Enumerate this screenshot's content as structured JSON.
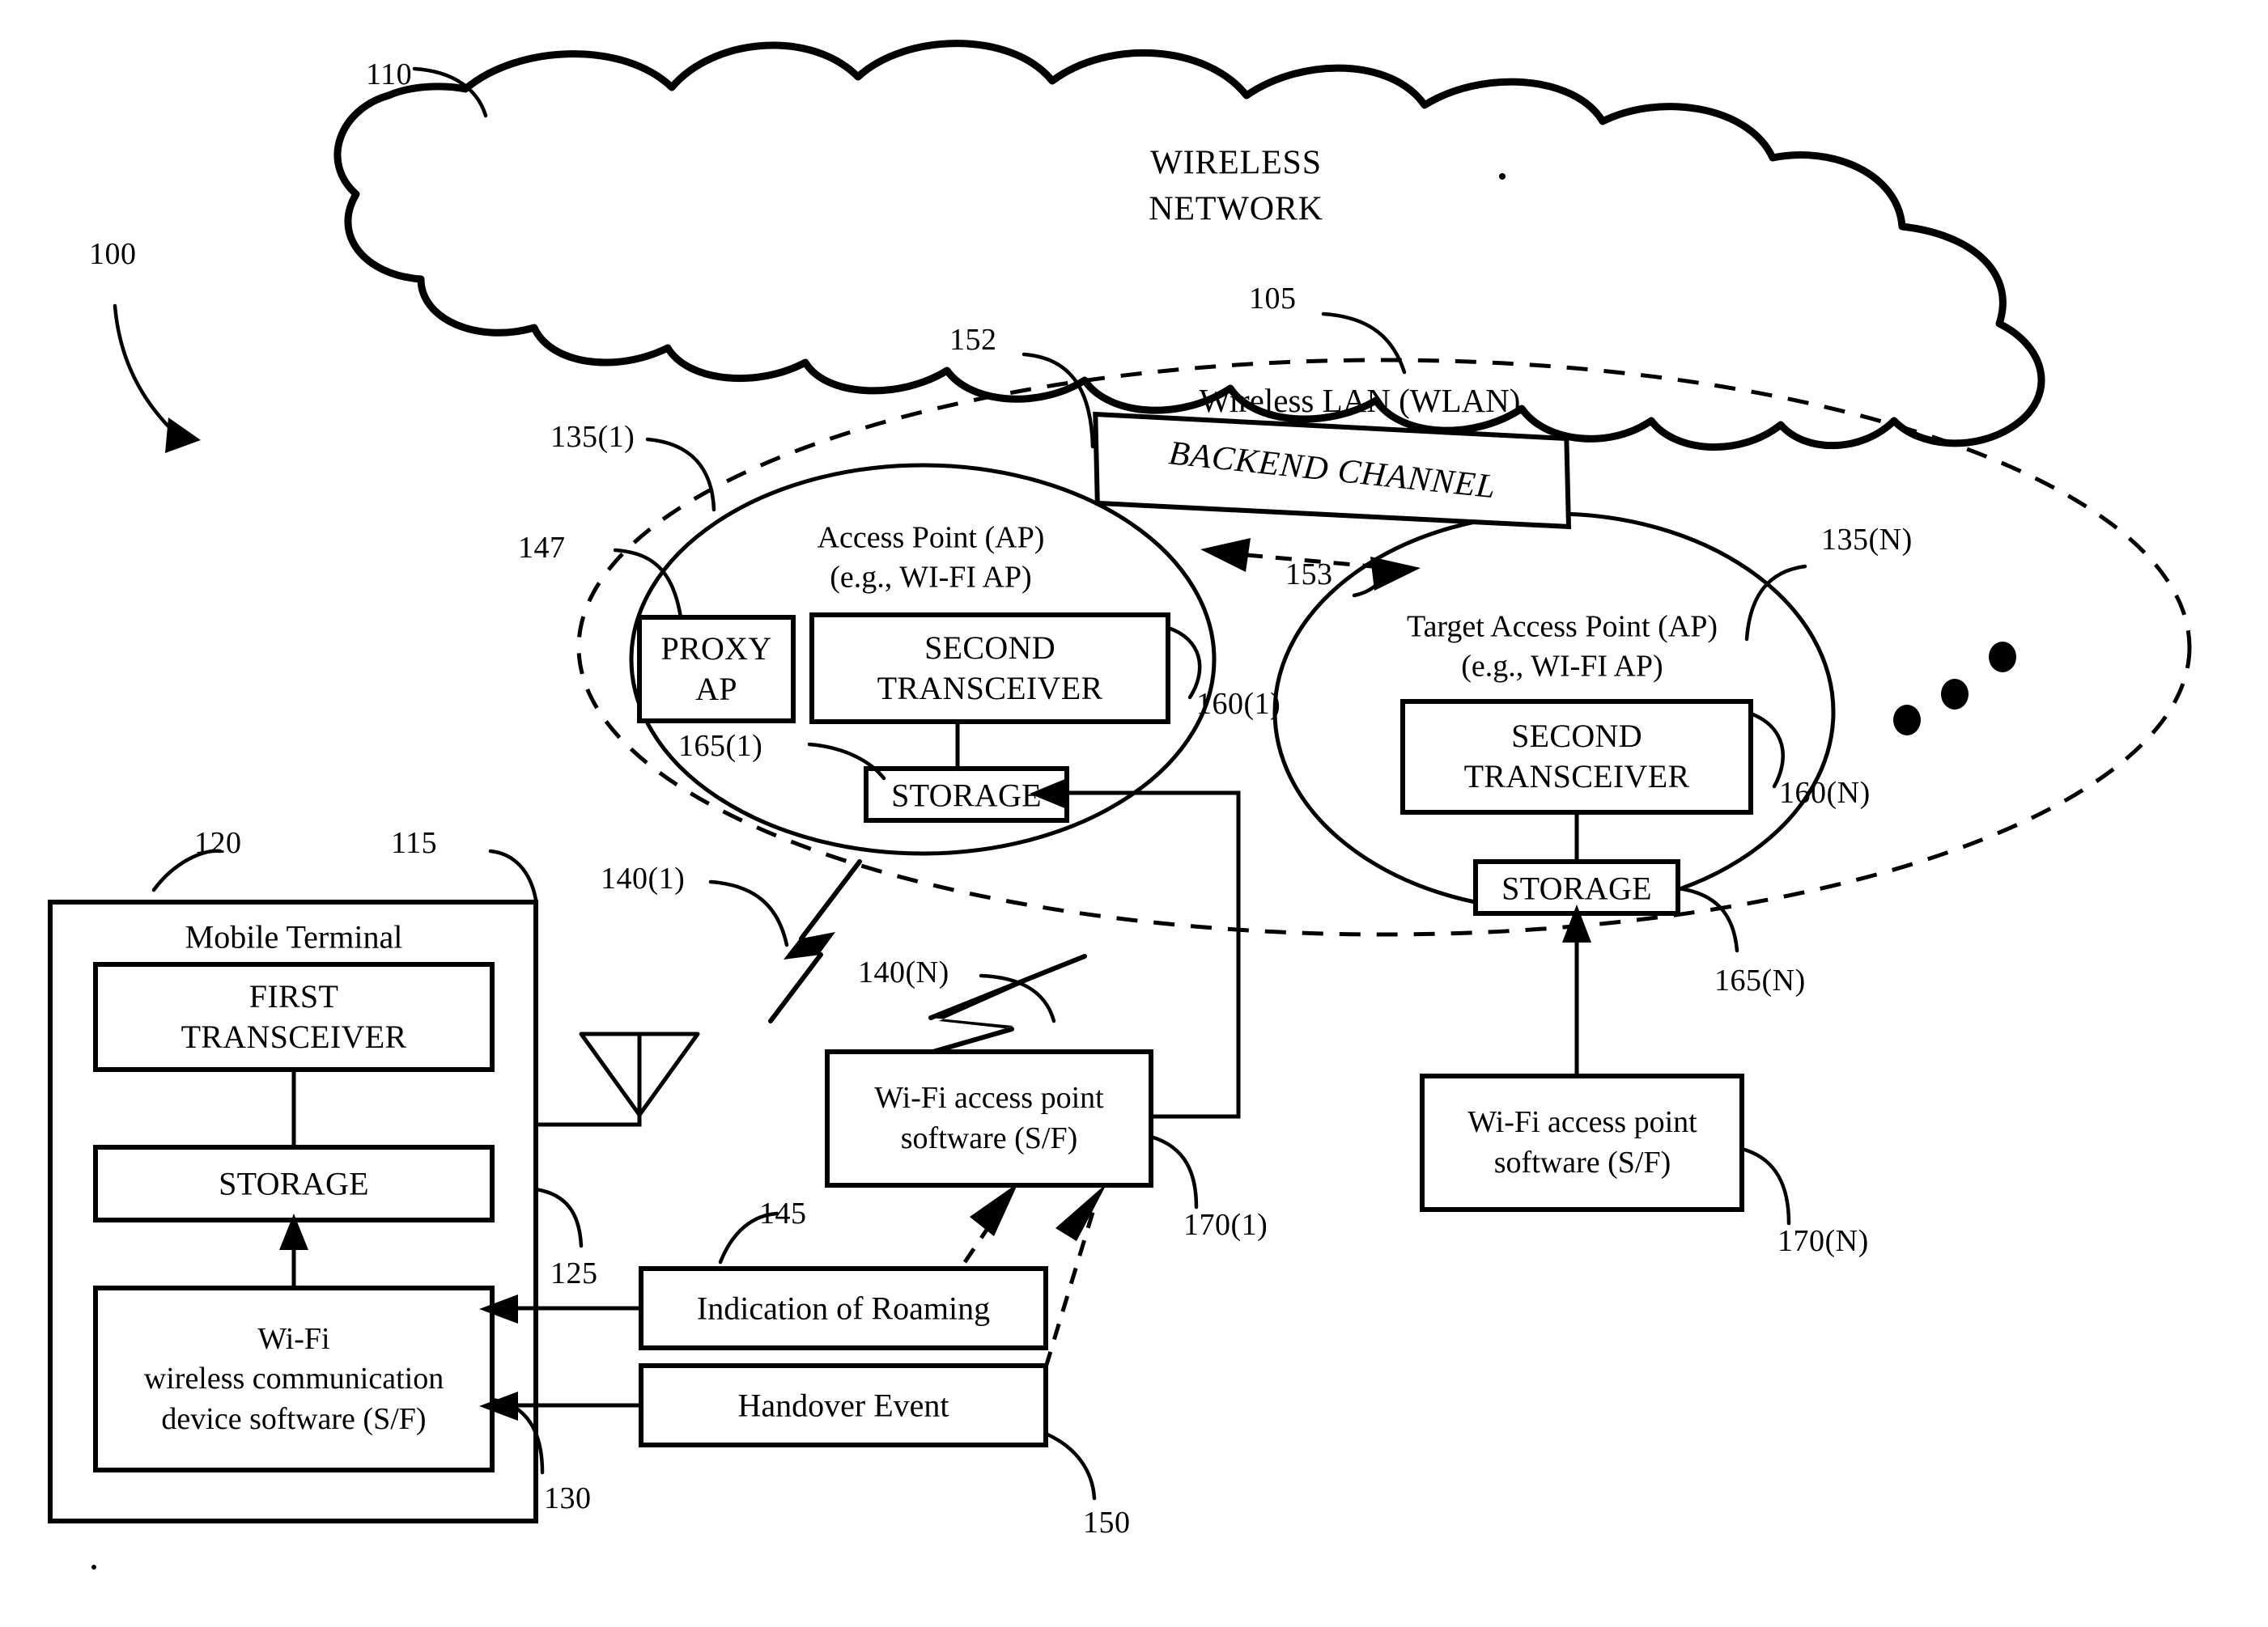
{
  "figure": {
    "reference_numeral_system": "100",
    "domain_note": "patent network topology diagram"
  },
  "cloud": {
    "title_line1": "WIRELESS",
    "title_line2": "NETWORK",
    "ref": "110"
  },
  "system_ref": "100",
  "wlan": {
    "label": "Wireless LAN (WLAN)",
    "ref": "105",
    "ellipse_ref": "152"
  },
  "backend_channel": {
    "label": "BACKEND CHANNEL",
    "ref": "153"
  },
  "access_point_1": {
    "title_line1": "Access Point (AP)",
    "title_line2": "(e.g., WI-FI AP)",
    "ref": "135(1)",
    "proxy_ap": {
      "line1": "PROXY",
      "line2": "AP",
      "ref": "147"
    },
    "second_transceiver": {
      "line1": "SECOND",
      "line2": "TRANSCEIVER",
      "ref": "160(1)"
    },
    "storage": {
      "label": "STORAGE",
      "ref": "165(1)"
    }
  },
  "access_point_n": {
    "title_line1": "Target Access Point (AP)",
    "title_line2": "(e.g., WI-FI AP)",
    "ref": "135(N)",
    "second_transceiver": {
      "line1": "SECOND",
      "line2": "TRANSCEIVER",
      "ref": "160(N)"
    },
    "storage": {
      "label": "STORAGE",
      "ref": "165(N)"
    }
  },
  "mobile_terminal": {
    "title": "Mobile Terminal",
    "ref": "115",
    "first_transceiver": {
      "line1": "FIRST",
      "line2": "TRANSCEIVER",
      "ref": "120"
    },
    "storage": {
      "label": "STORAGE",
      "ref": "125"
    },
    "wifi_device_software": {
      "line1": "Wi-Fi",
      "line2": "wireless communication",
      "line3": "device software (S/F)",
      "ref": "130"
    }
  },
  "wireless_links": {
    "link_1_ref": "140(1)",
    "link_n_ref": "140(N)"
  },
  "ap_software_1": {
    "line1": "Wi-Fi access point",
    "line2": "software (S/F)",
    "ref": "170(1)"
  },
  "ap_software_n": {
    "line1": "Wi-Fi access point",
    "line2": "software (S/F)",
    "ref": "170(N)"
  },
  "indication_of_roaming": {
    "label": "Indication of Roaming",
    "ref": "145"
  },
  "handover_event": {
    "label": "Handover Event",
    "ref": "150"
  },
  "ellipsis_dots": "• • •",
  "colors": {
    "ink": "#000000",
    "paper": "#ffffff"
  }
}
